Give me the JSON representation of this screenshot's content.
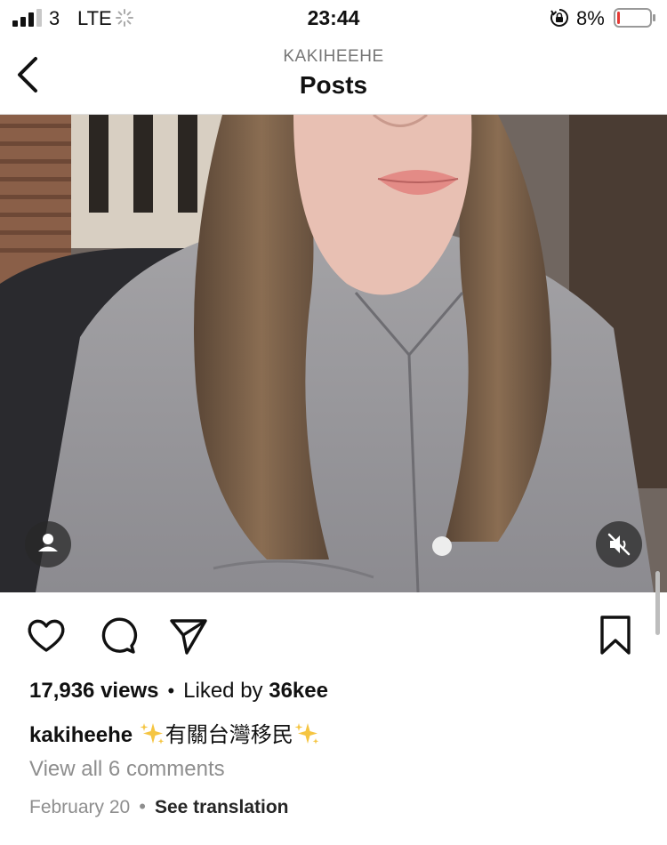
{
  "status_bar": {
    "carrier": "3",
    "network": "LTE",
    "time": "23:44",
    "battery_percent": "8%",
    "battery_level": 0.08
  },
  "nav": {
    "username": "KAKIHEEHE",
    "title": "Posts"
  },
  "post": {
    "views": "17,936 views",
    "liked_by_prefix": "Liked by",
    "liked_by_user": "36kee",
    "author": "kakiheehe",
    "caption_text": "有關台灣移民",
    "view_comments": "View all 6 comments",
    "date": "February 20",
    "see_translation": "See translation"
  },
  "icons": {
    "like": "heart-icon",
    "comment": "comment-bubble-icon",
    "share": "paper-plane-icon",
    "save": "bookmark-icon",
    "mute": "speaker-muted-icon",
    "tag": "person-icon"
  },
  "colors": {
    "accent_sparkle": "#f5c542",
    "secondary_text": "#8e8e8e",
    "battery_low": "#e53935"
  }
}
